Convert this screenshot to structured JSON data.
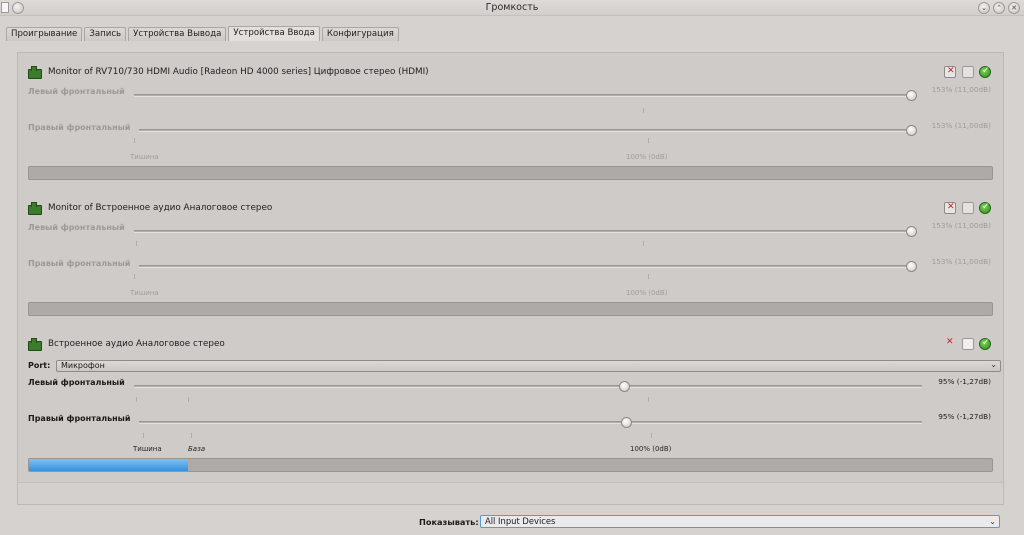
{
  "window": {
    "title": "Громкость"
  },
  "tabs": [
    {
      "label": "Проигрывание"
    },
    {
      "label": "Запись"
    },
    {
      "label": "Устройства Вывода"
    },
    {
      "label": "Устройства Ввода"
    },
    {
      "label": "Конфигурация"
    }
  ],
  "active_tab": 3,
  "devices": [
    {
      "name": "Monitor of RV710/730 HDMI Audio [Radeon HD 4000 series] Цифровое стерео (HDMI)",
      "channels": [
        {
          "label": "Левый фронтальный",
          "value_text": "153% (11,00dB)",
          "level_pct": 153
        },
        {
          "label": "Правый фронтальный",
          "value_text": "153% (11,00dB)",
          "level_pct": 153
        }
      ],
      "marks": {
        "silence": "Тишина",
        "base": "",
        "full": "100% (0dB)"
      },
      "meter_fraction": 0,
      "enabled": false
    },
    {
      "name": "Monitor of Встроенное аудио Аналоговое стерео",
      "channels": [
        {
          "label": "Левый фронтальный",
          "value_text": "153% (11,00dB)",
          "level_pct": 153
        },
        {
          "label": "Правый фронтальный",
          "value_text": "153% (11,00dB)",
          "level_pct": 153
        }
      ],
      "marks": {
        "silence": "Тишина",
        "base": "",
        "full": "100% (0dB)"
      },
      "meter_fraction": 0,
      "enabled": false
    },
    {
      "name": "Встроенное аудио Аналоговое стерео",
      "port": {
        "label": "Port:",
        "value": "Микрофон"
      },
      "channels": [
        {
          "label": "Левый фронтальный",
          "value_text": "95% (-1,27dB)",
          "level_pct": 95
        },
        {
          "label": "Правый фронтальный",
          "value_text": "95% (-1,27dB)",
          "level_pct": 95
        }
      ],
      "marks": {
        "silence": "Тишина",
        "base": "База",
        "full": "100% (0dB)"
      },
      "meter_fraction": 0.165,
      "enabled": true
    }
  ],
  "bottom": {
    "show_label": "Показывать:",
    "show_value": "All Input Devices"
  },
  "colors": {
    "meter_fill": "#3391e3",
    "default_check": "#2f8a1b",
    "mute_x": "#cc2222"
  }
}
